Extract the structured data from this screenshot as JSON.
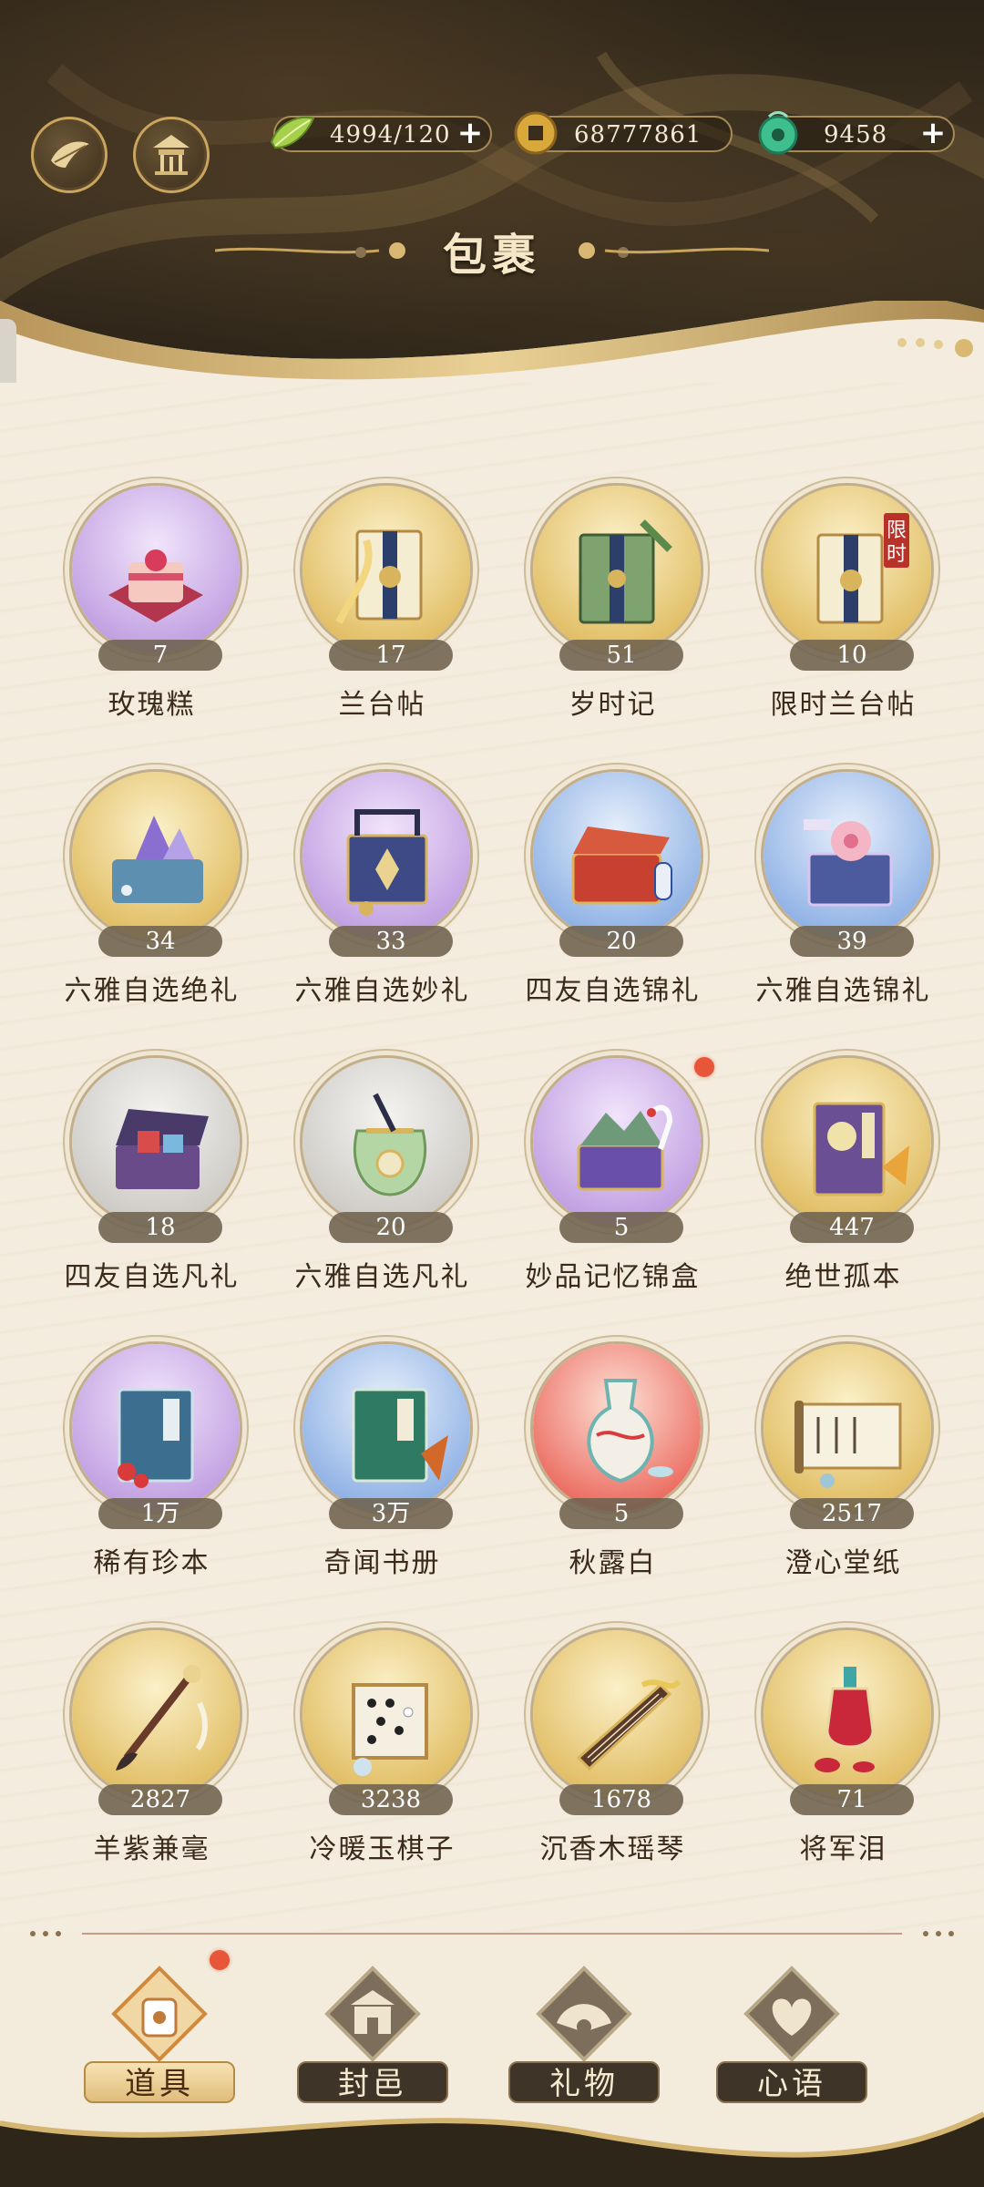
{
  "header": {
    "title": "包裹",
    "buttons": [
      {
        "icon": "leaf-emblem-icon"
      },
      {
        "icon": "pavilion-icon"
      }
    ],
    "resources": [
      {
        "icon": "green-leaf-icon",
        "value": "4994/120",
        "has_plus": true
      },
      {
        "icon": "copper-coin-icon",
        "value": "68777861",
        "has_plus": false
      },
      {
        "icon": "jade-bead-icon",
        "value": "9458",
        "has_plus": true
      }
    ]
  },
  "items": [
    {
      "name": "玫瑰糕",
      "count": "7",
      "bg": "purple",
      "icon": "rose-cake-icon"
    },
    {
      "name": "兰台帖",
      "count": "17",
      "bg": "gold",
      "icon": "lantai-note-icon"
    },
    {
      "name": "岁时记",
      "count": "51",
      "bg": "gold",
      "icon": "almanac-book-icon"
    },
    {
      "name": "限时兰台帖",
      "count": "10",
      "bg": "gold",
      "icon": "limited-lantai-note-icon",
      "tag": "限时"
    },
    {
      "name": "六雅自选绝礼",
      "count": "34",
      "bg": "gold",
      "icon": "gem-box-icon"
    },
    {
      "name": "六雅自选妙礼",
      "count": "33",
      "bg": "purple",
      "icon": "lacquer-box-icon"
    },
    {
      "name": "四友自选锦礼",
      "count": "20",
      "bg": "blue",
      "icon": "red-chest-icon"
    },
    {
      "name": "六雅自选锦礼",
      "count": "39",
      "bg": "blue",
      "icon": "flower-box-icon"
    },
    {
      "name": "四友自选凡礼",
      "count": "18",
      "bg": "grey",
      "icon": "open-chest-icon"
    },
    {
      "name": "六雅自选凡礼",
      "count": "20",
      "bg": "grey",
      "icon": "pouch-icon"
    },
    {
      "name": "妙品记忆锦盒",
      "count": "5",
      "bg": "purple",
      "icon": "crane-box-icon",
      "dot": true
    },
    {
      "name": "绝世孤本",
      "count": "447",
      "bg": "gold",
      "icon": "rare-book-icon"
    },
    {
      "name": "稀有珍本",
      "count": "1万",
      "bg": "purple",
      "icon": "blue-book-icon"
    },
    {
      "name": "奇闻书册",
      "count": "3万",
      "bg": "blue",
      "icon": "green-book-icon"
    },
    {
      "name": "秋露白",
      "count": "5",
      "bg": "red",
      "icon": "wine-vase-icon"
    },
    {
      "name": "澄心堂纸",
      "count": "2517",
      "bg": "gold",
      "icon": "paper-scroll-icon"
    },
    {
      "name": "羊紫兼毫",
      "count": "2827",
      "bg": "gold",
      "icon": "brush-icon"
    },
    {
      "name": "冷暖玉棋子",
      "count": "3238",
      "bg": "gold",
      "icon": "go-board-icon"
    },
    {
      "name": "沉香木瑶琴",
      "count": "1678",
      "bg": "gold",
      "icon": "guqin-icon"
    },
    {
      "name": "将军泪",
      "count": "71",
      "bg": "gold",
      "icon": "wine-bottle-icon"
    }
  ],
  "nav": [
    {
      "label": "道具",
      "icon": "items-jar-icon",
      "active": true,
      "dot": true
    },
    {
      "label": "封邑",
      "icon": "gate-icon",
      "active": false
    },
    {
      "label": "礼物",
      "icon": "fan-flower-icon",
      "active": false
    },
    {
      "label": "心语",
      "icon": "heart-knot-icon",
      "active": false
    }
  ],
  "colors": {
    "purple": "#c9a6e6",
    "gold": "#e6c468",
    "blue": "#8fb0e8",
    "grey": "#d3d0cb",
    "red": "#ec6a5a"
  }
}
